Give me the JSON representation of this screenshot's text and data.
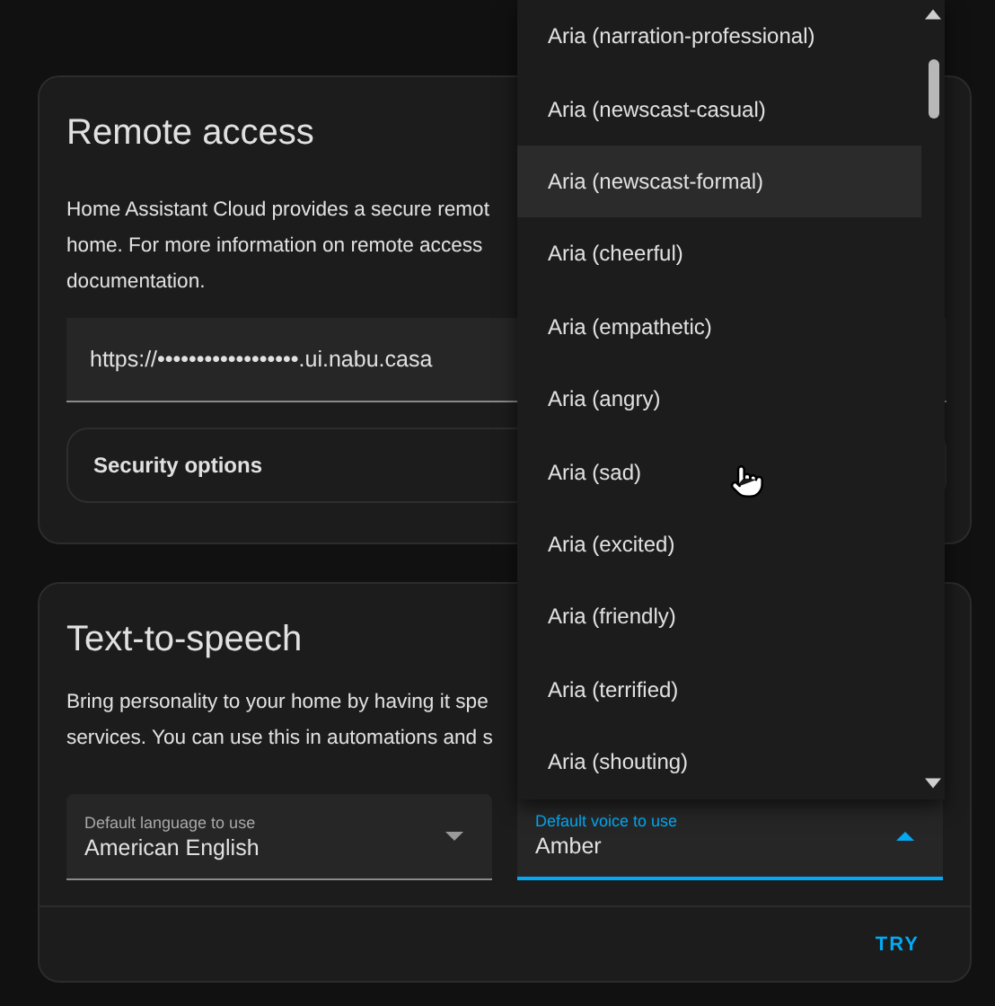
{
  "remote_access": {
    "title": "Remote access",
    "description_lines": [
      "Home Assistant Cloud provides a secure remot",
      "home. For more information on remote access",
      "documentation."
    ],
    "url": "https://••••••••••••••••••.ui.nabu.casa",
    "security_options": "Security options"
  },
  "text_to_speech": {
    "title": "Text-to-speech",
    "description_lines": [
      "Bring personality to your home by having it spe",
      "services. You can use this in automations and s"
    ],
    "selects": [
      {
        "label": "Default language to use",
        "value": "American English",
        "expanded": false
      },
      {
        "label": "Default voice to use",
        "value": "Amber",
        "expanded": true
      }
    ],
    "action": "TRY"
  },
  "voice_menu": {
    "items": [
      {
        "label": "Aria (narration-professional)",
        "hovered": false
      },
      {
        "label": "Aria (newscast-casual)",
        "hovered": false
      },
      {
        "label": "Aria (newscast-formal)",
        "hovered": true
      },
      {
        "label": "Aria (cheerful)",
        "hovered": false
      },
      {
        "label": "Aria (empathetic)",
        "hovered": false
      },
      {
        "label": "Aria (angry)",
        "hovered": false
      },
      {
        "label": "Aria (sad)",
        "hovered": false
      },
      {
        "label": "Aria (excited)",
        "hovered": false
      },
      {
        "label": "Aria (friendly)",
        "hovered": false
      },
      {
        "label": "Aria (terrified)",
        "hovered": false
      },
      {
        "label": "Aria (shouting)",
        "hovered": false
      }
    ]
  }
}
